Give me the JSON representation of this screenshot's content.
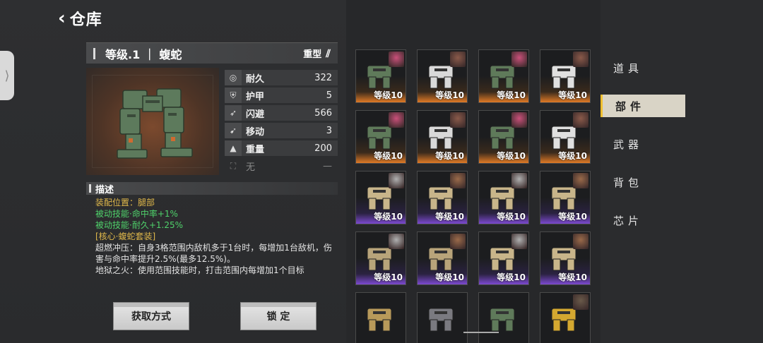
{
  "header": {
    "title": "仓库"
  },
  "item": {
    "name": "等级.1 ｜ 蝮蛇",
    "type": "重型"
  },
  "stats": [
    {
      "icon": "durability-icon",
      "glyph": "◎",
      "name": "耐久",
      "value": "322"
    },
    {
      "icon": "armor-icon",
      "glyph": "⛨",
      "name": "护甲",
      "value": "5"
    },
    {
      "icon": "evade-icon",
      "glyph": "➶",
      "name": "闪避",
      "value": "566"
    },
    {
      "icon": "move-icon",
      "glyph": "➹",
      "name": "移动",
      "value": "3"
    },
    {
      "icon": "weight-icon",
      "glyph": "▲",
      "name": "重量",
      "value": "200"
    },
    {
      "icon": "none-icon",
      "glyph": "⛶",
      "name": "无",
      "value": "—"
    }
  ],
  "description": {
    "title": "描述",
    "slot": "装配位置：腿部",
    "passive1": "被动技能·命中率+1%",
    "passive2": "被动技能·耐久+1.25%",
    "set_name": "[核心·蝮蛇套装]",
    "set_text1": "超燃冲压：自身3格范围内敌机多于1台时，每增加1台敌机，伤害与命中率提升2.5%(最多12.5%)。",
    "set_text2": "地狱之火：使用范围技能时，打击范围内每增加1个目标"
  },
  "buttons": {
    "obtain": "获取方式",
    "lock": "锁 定"
  },
  "grid": {
    "level_label": "等级10",
    "cards": [
      {
        "rarity": "orange",
        "robot": "#5f7a5a",
        "portrait": "#c9507a"
      },
      {
        "rarity": "orange",
        "robot": "#d9d9d9",
        "portrait": "#8a5a4a"
      },
      {
        "rarity": "orange",
        "robot": "#5f7a5a",
        "portrait": "#c9507a"
      },
      {
        "rarity": "orange",
        "robot": "#e0e0e0",
        "portrait": "#8a5a4a"
      },
      {
        "rarity": "orange",
        "robot": "#5f7a5a",
        "portrait": "#c9507a"
      },
      {
        "rarity": "orange",
        "robot": "#d9d9d9",
        "portrait": "#8a5a4a"
      },
      {
        "rarity": "orange",
        "robot": "#5f7a5a",
        "portrait": "#c9507a"
      },
      {
        "rarity": "orange",
        "robot": "#e0e0e0",
        "portrait": "#8a5a4a"
      },
      {
        "rarity": "purple",
        "robot": "#c8b58a",
        "portrait": "#b0b0b0"
      },
      {
        "rarity": "purple",
        "robot": "#c8b58a",
        "portrait": "#9a6a4a"
      },
      {
        "rarity": "purple",
        "robot": "#c8b58a",
        "portrait": "#b0b0b0"
      },
      {
        "rarity": "purple",
        "robot": "#c8b58a",
        "portrait": "#9a6a4a"
      },
      {
        "rarity": "purple",
        "robot": "#b8a47a",
        "portrait": "#b0b0b0"
      },
      {
        "rarity": "purple",
        "robot": "#b8a47a",
        "portrait": "#9a6a4a"
      },
      {
        "rarity": "purple",
        "robot": "#c8b58a",
        "portrait": "#b0b0b0"
      },
      {
        "rarity": "purple",
        "robot": "#c8b58a",
        "portrait": "#9a6a4a"
      },
      {
        "rarity": "plain",
        "robot": "#b89a5a",
        "portrait": ""
      },
      {
        "rarity": "plain",
        "robot": "#7a7a80",
        "portrait": ""
      },
      {
        "rarity": "plain",
        "robot": "#5f7a5a",
        "portrait": ""
      },
      {
        "rarity": "plain",
        "robot": "#d4a830",
        "portrait": "#6a5a4a"
      }
    ]
  },
  "tabs": [
    {
      "label": "道具",
      "active": false
    },
    {
      "label": "部件",
      "active": true
    },
    {
      "label": "武器",
      "active": false
    },
    {
      "label": "背包",
      "active": false
    },
    {
      "label": "芯片",
      "active": false
    }
  ],
  "colors": {
    "accent": "#f0c030",
    "rarity_orange": "#e07a26",
    "rarity_purple": "#7c4ad0",
    "text_green": "#4fd06a",
    "text_yellow": "#e0b84a"
  }
}
